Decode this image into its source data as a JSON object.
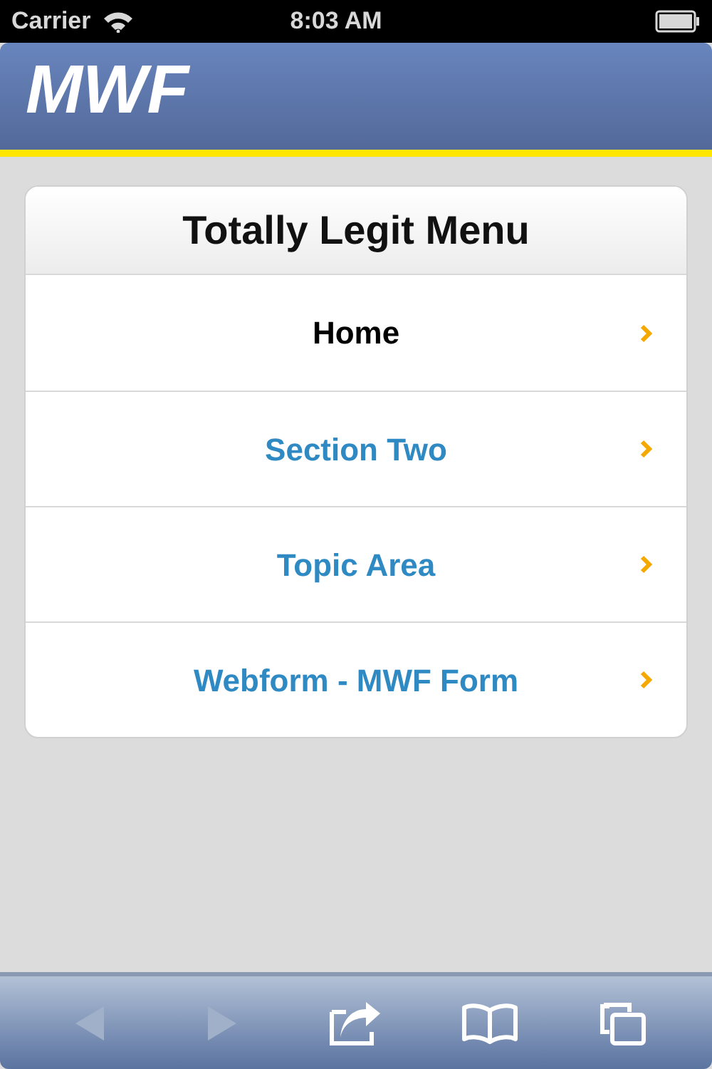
{
  "status_bar": {
    "carrier": "Carrier",
    "time": "8:03 AM"
  },
  "header": {
    "logo": "MWF"
  },
  "menu": {
    "title": "Totally Legit Menu",
    "items": [
      {
        "label": "Home",
        "selected": true
      },
      {
        "label": "Section Two",
        "selected": false
      },
      {
        "label": "Topic Area",
        "selected": false
      },
      {
        "label": "Webform - MWF Form",
        "selected": false
      }
    ]
  },
  "toolbar": [
    {
      "kind": "back",
      "disabled": true
    },
    {
      "kind": "forward",
      "disabled": true
    },
    {
      "kind": "share",
      "disabled": false
    },
    {
      "kind": "bookmarks",
      "disabled": false
    },
    {
      "kind": "tabs",
      "disabled": false
    }
  ]
}
